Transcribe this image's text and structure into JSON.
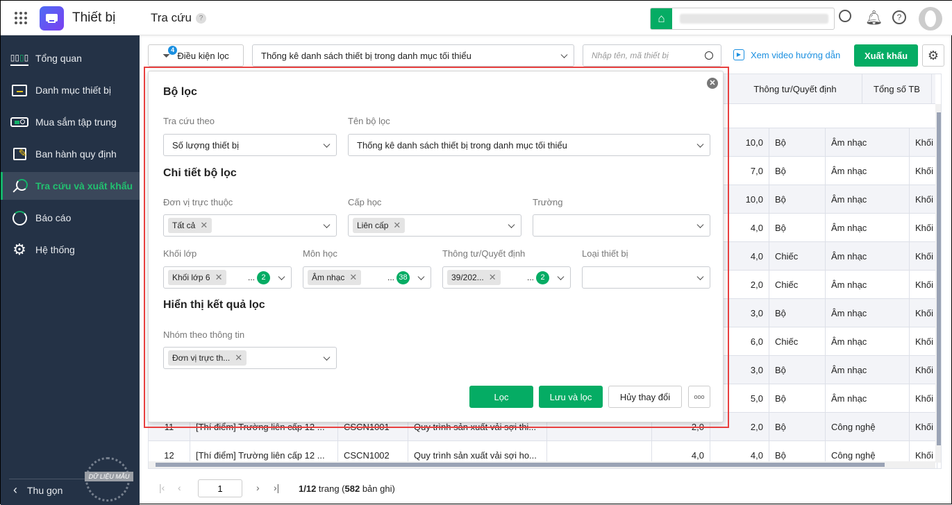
{
  "header": {
    "app_title": "Thiết bị",
    "page_title": "Tra cứu",
    "help_badge": "?"
  },
  "colors": {
    "accent": "#05ac64",
    "sidebar_bg": "#243246",
    "app_icon": "#5b4ef0",
    "highlight": "#e8403f",
    "link": "#1a8fe0"
  },
  "sidebar": {
    "items": [
      {
        "label": "Tổng quan",
        "icon": "chart-bars-icon"
      },
      {
        "label": "Danh mục thiết bị",
        "icon": "folder-icon"
      },
      {
        "label": "Mua sắm tập trung",
        "icon": "projector-icon"
      },
      {
        "label": "Ban hành quy định",
        "icon": "edit-icon"
      },
      {
        "label": "Tra cứu và xuất khẩu",
        "icon": "search-icon",
        "active": true
      },
      {
        "label": "Báo cáo",
        "icon": "pie-chart-icon"
      },
      {
        "label": "Hệ thống",
        "icon": "gear-icon"
      }
    ],
    "collapse_label": "Thu gọn",
    "watermark": "DỮ LIỆU MẪU"
  },
  "toolbar": {
    "filter_label": "Điều kiện lọc",
    "filter_count": "4",
    "saved_filter": "Thống kê danh sách thiết bị trong danh mục tối thiểu",
    "search_placeholder": "Nhập tên, mã thiết bị",
    "video_link": "Xem video hướng dẫn",
    "export_label": "Xuất khẩu"
  },
  "table": {
    "headers": {
      "circular": "Thông tư/Quyết định",
      "total": "Tổng số TB"
    },
    "rows": [
      [
        "",
        "",
        "",
        "",
        "",
        "",
        "10,0",
        "Bộ",
        "Âm nhạc",
        "Khối"
      ],
      [
        "",
        "",
        "",
        "",
        "",
        "",
        "7,0",
        "Bộ",
        "Âm nhạc",
        "Khối"
      ],
      [
        "",
        "",
        "",
        "",
        "",
        "",
        "10,0",
        "Bộ",
        "Âm nhạc",
        "Khối"
      ],
      [
        "",
        "",
        "",
        "",
        "",
        "",
        "4,0",
        "Bộ",
        "Âm nhạc",
        "Khối"
      ],
      [
        "",
        "",
        "",
        "",
        "",
        "",
        "4,0",
        "Chiếc",
        "Âm nhạc",
        "Khối"
      ],
      [
        "",
        "",
        "",
        "",
        "",
        "",
        "2,0",
        "Chiếc",
        "Âm nhạc",
        "Khối"
      ],
      [
        "",
        "",
        "",
        "",
        "",
        "",
        "3,0",
        "Bộ",
        "Âm nhạc",
        "Khối"
      ],
      [
        "",
        "",
        "",
        "",
        "",
        "",
        "6,0",
        "Chiếc",
        "Âm nhạc",
        "Khối"
      ],
      [
        "",
        "",
        "",
        "",
        "",
        "",
        "3,0",
        "Bộ",
        "Âm nhạc",
        "Khối"
      ],
      [
        "",
        "",
        "",
        "",
        "",
        "",
        "5,0",
        "Bộ",
        "Âm nhạc",
        "Khối"
      ],
      [
        "11",
        "[Thí điểm] Trường liên cấp 12 ...",
        "CSCN1001",
        "Quy trình sản xuất vải sợi thi...",
        "",
        "2,0",
        "2,0",
        "Bộ",
        "Công nghệ",
        "Khối"
      ],
      [
        "12",
        "[Thí điểm] Trường liên cấp 12 ...",
        "CSCN1002",
        "Quy trình sản xuất vải sợi ho...",
        "",
        "4,0",
        "4,0",
        "Bộ",
        "Công nghệ",
        "Khối"
      ]
    ]
  },
  "pagination": {
    "page_value": "1",
    "page_info": "1/12",
    "page_word": " trang (",
    "records": "582",
    "records_word": " bản ghi)"
  },
  "filter_panel": {
    "title": "Bộ lọc",
    "lookup_by_label": "Tra cứu theo",
    "lookup_by_value": "Số lượng thiết bị",
    "filter_name_label": "Tên bộ lọc",
    "filter_name_value": "Thống kê danh sách thiết bị trong danh mục tối thiểu",
    "detail_title": "Chi tiết bộ lọc",
    "unit_label": "Đơn vị trực thuộc",
    "unit_tag": "Tất cả",
    "level_label": "Cấp học",
    "level_tag": "Liên cấp",
    "school_label": "Trường",
    "grade_label": "Khối lớp",
    "grade_tag": "Khối lớp 6",
    "grade_more": "2",
    "subject_label": "Môn học",
    "subject_tag": "Âm nhạc",
    "subject_more": "38",
    "circular_label": "Thông tư/Quyết định",
    "circular_tag": "39/202...",
    "circular_more": "2",
    "type_label": "Loại thiết bị",
    "display_title": "Hiển thị kết quả lọc",
    "group_label": "Nhóm theo thông tin",
    "group_tag": "Đơn vị trực th...",
    "apply_label": "Lọc",
    "save_apply_label": "Lưu và lọc",
    "cancel_label": "Hủy thay đổi",
    "ellipsis": "...",
    "more_label": "ooo"
  }
}
